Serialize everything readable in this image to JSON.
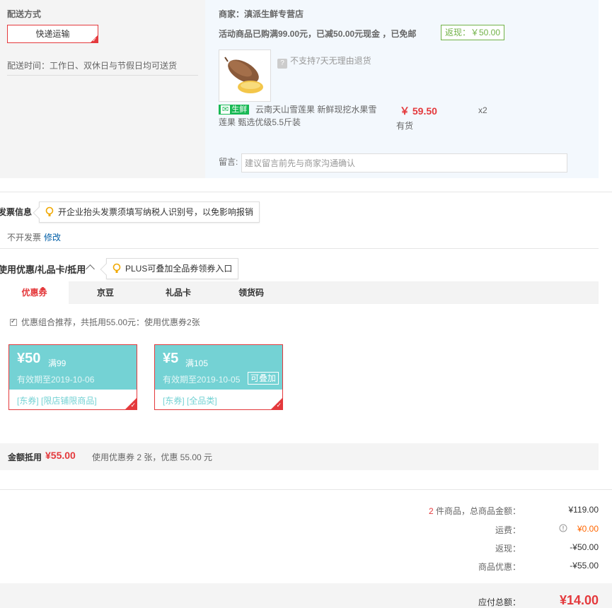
{
  "shipping": {
    "title": "配送方式",
    "method_button": "快递运输",
    "time_label": "配送时间：工作日、双休日与节假日均可送货"
  },
  "order": {
    "shop_name": "商家：滇派生鲜专营店",
    "promo_text": "活动商品已购满99.00元，已减50.00元现金 ，已免邮",
    "rebate_tag": "返现：￥50.00",
    "no_return_text": "不支持7天无理由退货",
    "fresh_badge": "生鲜",
    "product_name": "云南天山雪莲果 新鲜现挖水果雪莲果 甄选优级5.5斤装",
    "price": "￥ 59.50",
    "quantity": "x2",
    "stock": "有货",
    "message_label": "留言:",
    "message_placeholder": "建议留言前先与商家沟通确认"
  },
  "invoice": {
    "title": "发票信息",
    "tip": "开企业抬头发票须填写纳税人识别号，以免影响报销",
    "value": "不开发票",
    "edit_link": "修改"
  },
  "coupons": {
    "title": "使用优惠/礼品卡/抵用",
    "plus_tip": "PLUS可叠加全品券领券入口",
    "tabs": [
      {
        "label": "优惠券"
      },
      {
        "label": "京豆"
      },
      {
        "label": "礼品卡"
      },
      {
        "label": "领货码"
      }
    ],
    "combo_text": "优惠组合推荐，共抵用55.00元：使用优惠券2张",
    "items": [
      {
        "amount": "¥50",
        "condition": "满99",
        "expiry": "有效期至2019-10-06",
        "scope": "[东券]  [限店铺限商品]"
      },
      {
        "amount": "¥5",
        "condition": "满105",
        "expiry": "有效期至2019-10-05",
        "stack_label": "可叠加",
        "scope": "[东券]  [全品类]"
      }
    ],
    "deduct_label": "金额抵用",
    "deduct_amount": "¥55.00",
    "deduct_desc": "使用优惠券 2 张，优惠 55.00 元"
  },
  "summary": {
    "count": "2",
    "count_label": " 件商品，总商品金额：",
    "total_goods": "¥119.00",
    "freight_label": "运费：",
    "freight": "¥0.00",
    "rebate_label": "返现：",
    "rebate": "-¥50.00",
    "discount_label": "商品优惠：",
    "discount": "-¥55.00",
    "payable_label": "应付总额：",
    "payable": "¥14.00"
  },
  "colors": {
    "accent_red": "#e4393c",
    "coupon_teal": "#74d2d4",
    "rebate_green": "#71b247",
    "fresh_green": "#19b955",
    "link_blue": "#005ea7"
  }
}
